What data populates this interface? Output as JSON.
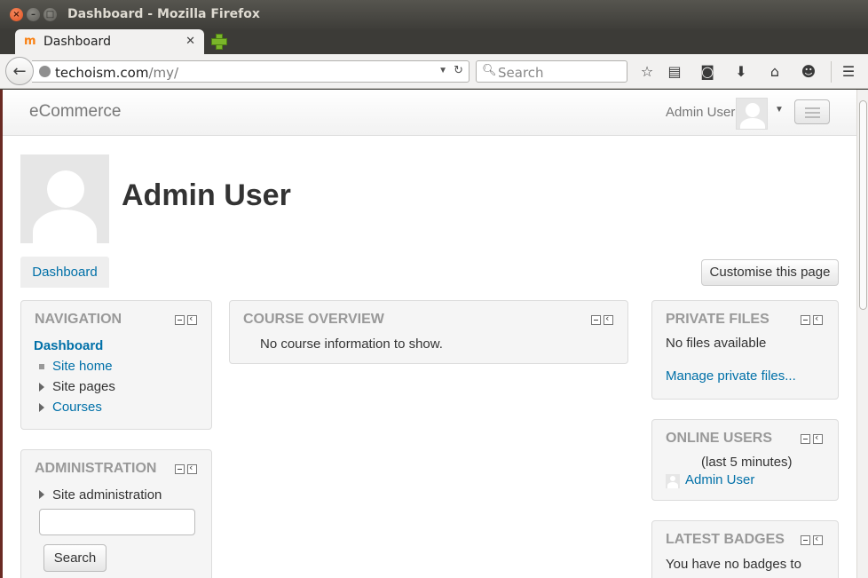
{
  "window": {
    "title": "Dashboard - Mozilla Firefox"
  },
  "browser": {
    "tab_label": "Dashboard",
    "url_host": "techoism.com",
    "url_path": "/my/",
    "search_placeholder": "Search",
    "toolbar_icons": [
      "bookmark-star-icon",
      "reading-list-icon",
      "pocket-icon",
      "download-icon",
      "home-icon",
      "chat-icon",
      "menu-icon"
    ]
  },
  "site": {
    "brand": "eCommerce",
    "user_name": "Admin User"
  },
  "page": {
    "title": "Admin User",
    "tab_dashboard": "Dashboard",
    "customise_button": "Customise this page"
  },
  "navigation": {
    "title": "NAVIGATION",
    "current": "Dashboard",
    "items": [
      {
        "label": "Site home",
        "type": "link"
      },
      {
        "label": "Site pages",
        "type": "expand"
      },
      {
        "label": "Courses",
        "type": "expand-link"
      }
    ]
  },
  "administration": {
    "title": "ADMINISTRATION",
    "item": "Site administration",
    "search_button": "Search"
  },
  "course_overview": {
    "title": "COURSE OVERVIEW",
    "message": "No course information to show."
  },
  "private_files": {
    "title": "PRIVATE FILES",
    "message": "No files available",
    "manage_link": "Manage private files..."
  },
  "online_users": {
    "title": "ONLINE USERS",
    "subtitle": "(last 5 minutes)",
    "user": "Admin User"
  },
  "latest_badges": {
    "title": "LATEST BADGES",
    "message": "You have no badges to"
  }
}
